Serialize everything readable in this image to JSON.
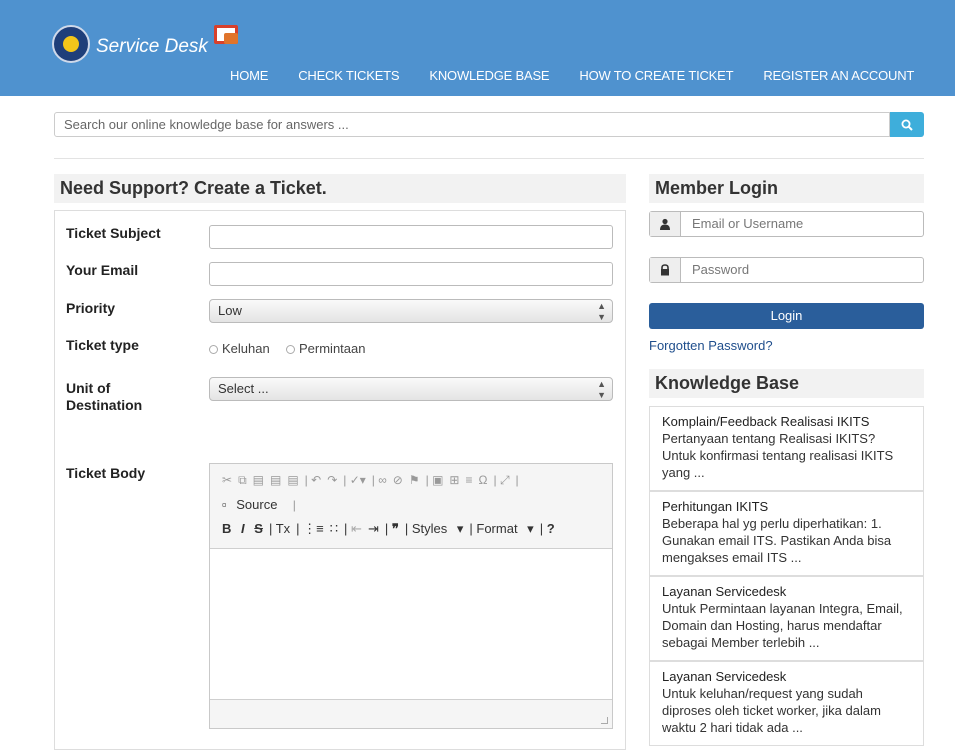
{
  "header": {
    "brand": "Service Desk",
    "nav": [
      "HOME",
      "CHECK TICKETS",
      "KNOWLEDGE BASE",
      "HOW TO CREATE TICKET",
      "REGISTER AN ACCOUNT"
    ]
  },
  "search": {
    "placeholder": "Search our online knowledge base for answers ...",
    "button_icon": "search-icon"
  },
  "ticket_form": {
    "title": "Need Support? Create a Ticket.",
    "subject_label": "Ticket Subject",
    "email_label": "Your Email",
    "priority_label": "Priority",
    "priority_value": "Low",
    "type_label": "Ticket type",
    "type_options": [
      "Keluhan",
      "Permintaan"
    ],
    "unit_label_1": "Unit of",
    "unit_label_2": "Destination",
    "unit_value": "Select ...",
    "body_label": "Ticket Body",
    "editor": {
      "source_label": "Source",
      "bold": "B",
      "italic": "I",
      "strike": "S",
      "styles_label": "Styles",
      "format_label": "Format",
      "help": "?"
    }
  },
  "login": {
    "title": "Member Login",
    "username_placeholder": "Email or Username",
    "password_placeholder": "Password",
    "button": "Login",
    "forgot": "Forgotten Password?"
  },
  "knowledge_base": {
    "title": "Knowledge Base",
    "articles": [
      {
        "title": "Komplain/Feedback Realisasi IKITS",
        "desc": "Pertanyaan tentang Realisasi IKITS? Untuk konfirmasi tentang realisasi IKITS yang ..."
      },
      {
        "title": "Perhitungan IKITS",
        "desc": "Beberapa hal yg perlu diperhatikan: 1. Gunakan email ITS. Pastikan Anda bisa mengakses email ITS ..."
      },
      {
        "title": "Layanan Servicedesk",
        "desc": "Untuk Permintaan layanan Integra, Email, Domain dan Hosting, harus mendaftar sebagai Member terlebih ..."
      },
      {
        "title": "Layanan Servicedesk",
        "desc": "Untuk keluhan/request yang sudah diproses oleh ticket worker, jika dalam waktu 2 hari tidak ada ..."
      }
    ]
  },
  "colors": {
    "header": "#4f92cf",
    "search_button": "#3eaedb",
    "login_button": "#2a5e9b"
  }
}
